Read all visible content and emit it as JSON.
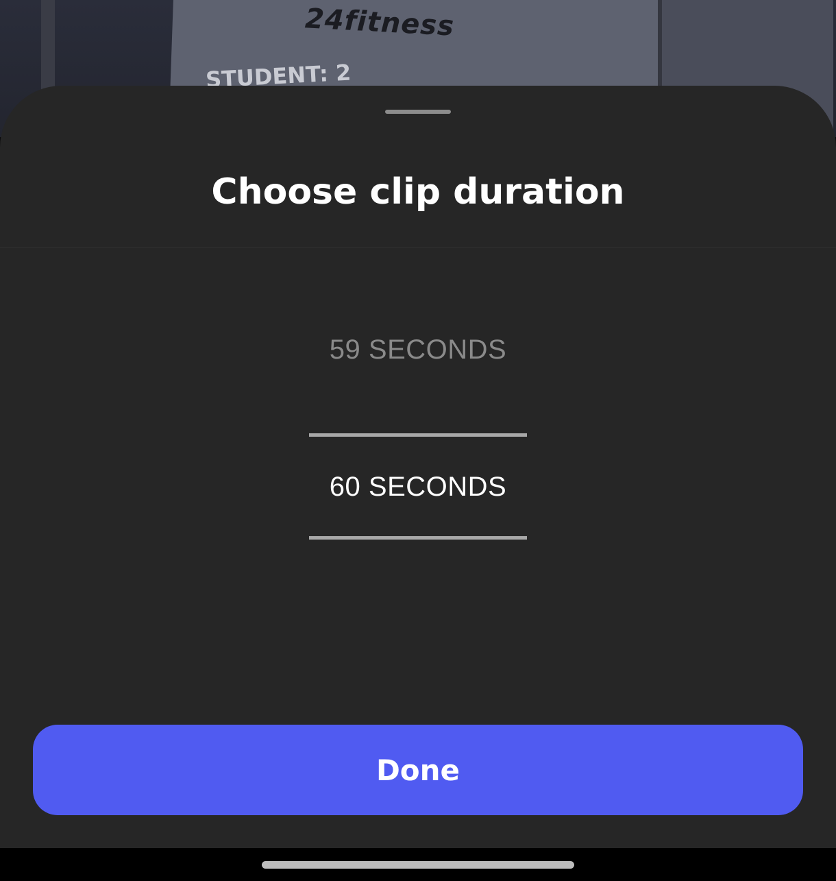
{
  "background_photo": {
    "brand_text": "24fitness",
    "student_text": "STUDENT: 2"
  },
  "sheet": {
    "title": "Choose clip duration",
    "picker": {
      "options": [
        "59 SECONDS",
        "60 SECONDS"
      ],
      "selected": "60 SECONDS"
    },
    "done_label": "Done"
  },
  "colors": {
    "sheet_bg": "#262626",
    "accent": "#505bf1",
    "text_primary": "#ffffff",
    "text_dim": "#8a8a8a"
  }
}
